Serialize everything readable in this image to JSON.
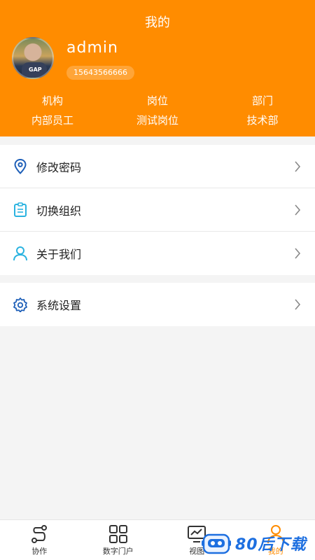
{
  "header": {
    "title": "我的",
    "username": "admin",
    "phone": "15643566666",
    "info": [
      {
        "label": "机构",
        "value": "内部员工"
      },
      {
        "label": "岗位",
        "value": "测试岗位"
      },
      {
        "label": "部门",
        "value": "技术部"
      }
    ]
  },
  "menu": {
    "items": [
      {
        "label": "修改密码",
        "icon": "location-pin-icon"
      },
      {
        "label": "切换组织",
        "icon": "clipboard-icon"
      },
      {
        "label": "关于我们",
        "icon": "user-icon"
      },
      {
        "label": "系统设置",
        "icon": "gear-icon"
      }
    ]
  },
  "tabbar": {
    "tabs": [
      {
        "label": "协作",
        "icon": "collaboration-icon"
      },
      {
        "label": "数字门户",
        "icon": "grid-icon"
      },
      {
        "label": "视图",
        "icon": "monitor-chart-icon"
      },
      {
        "label": "我的",
        "icon": "profile-icon",
        "active": true
      }
    ]
  },
  "watermark": {
    "text": "80后下载"
  },
  "colors": {
    "accent": "#ff8c00",
    "icon_blue": "#1e5fb8",
    "icon_cyan": "#2ab3e0"
  }
}
